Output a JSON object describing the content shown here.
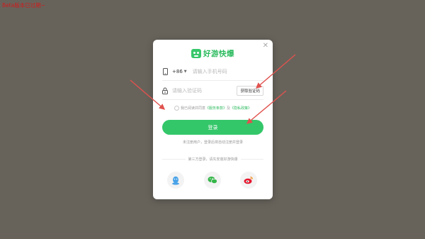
{
  "beta_notice": "Beta版本已过期~",
  "brand": {
    "name": "好游快爆"
  },
  "phone": {
    "country_code": "+86",
    "placeholder": "请输入手机号码"
  },
  "code": {
    "placeholder": "请输入验证码",
    "get_code_label": "获取验证码"
  },
  "agreement": {
    "prefix": "我已阅读并同意",
    "terms": "《服务条款》",
    "and": "及",
    "privacy": "《隐私政策》"
  },
  "login_button": "登录",
  "note": "未注册用户，登录后将自动注册并登录",
  "third_party": "第三方登录，请先安装好游快爆",
  "social": [
    "qq-icon",
    "wechat-icon",
    "weibo-icon"
  ],
  "colors": {
    "accent": "#34c76a",
    "overlay": "#67635b",
    "annotation": "#e0524e"
  }
}
